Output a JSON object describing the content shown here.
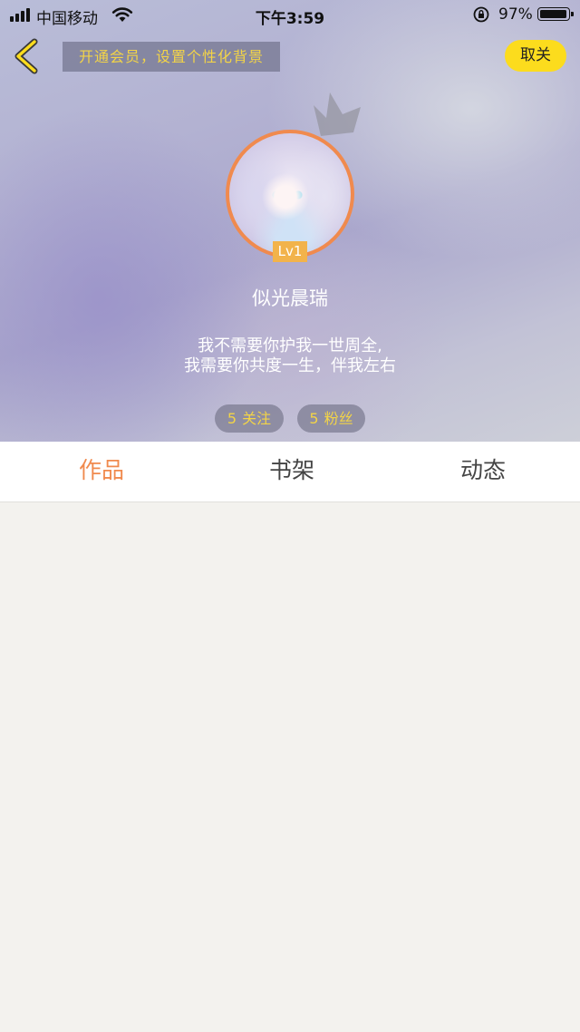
{
  "status_bar": {
    "carrier": "中国移动",
    "time": "下午3:59",
    "battery_percent": "97%",
    "signal_icon": "signal-bars-icon",
    "wifi_icon": "wifi-icon",
    "orientation_lock_icon": "rotation-lock-icon",
    "battery_icon": "battery-icon",
    "battery_level": 0.97
  },
  "header": {
    "back_icon": "chevron-left-icon",
    "vip_banner": "开通会员，设置个性化背景",
    "unfollow_label": "取关"
  },
  "profile": {
    "level": "Lv1",
    "username": "似光晨瑞",
    "bio_lines": [
      "我不需要你护我一世周全,",
      "我需要你共度一生，伴我左右"
    ],
    "following_count": "5",
    "following_label": "关注",
    "fans_count": "5",
    "fans_label": "粉丝"
  },
  "tabs": [
    {
      "label": "作品",
      "active": true
    },
    {
      "label": "书架",
      "active": false
    },
    {
      "label": "动态",
      "active": false
    }
  ],
  "colors": {
    "accent_orange": "#f08a4e",
    "accent_yellow": "#fcdc1d",
    "stat_text": "#f3d447",
    "level_badge": "#f2b34b"
  }
}
